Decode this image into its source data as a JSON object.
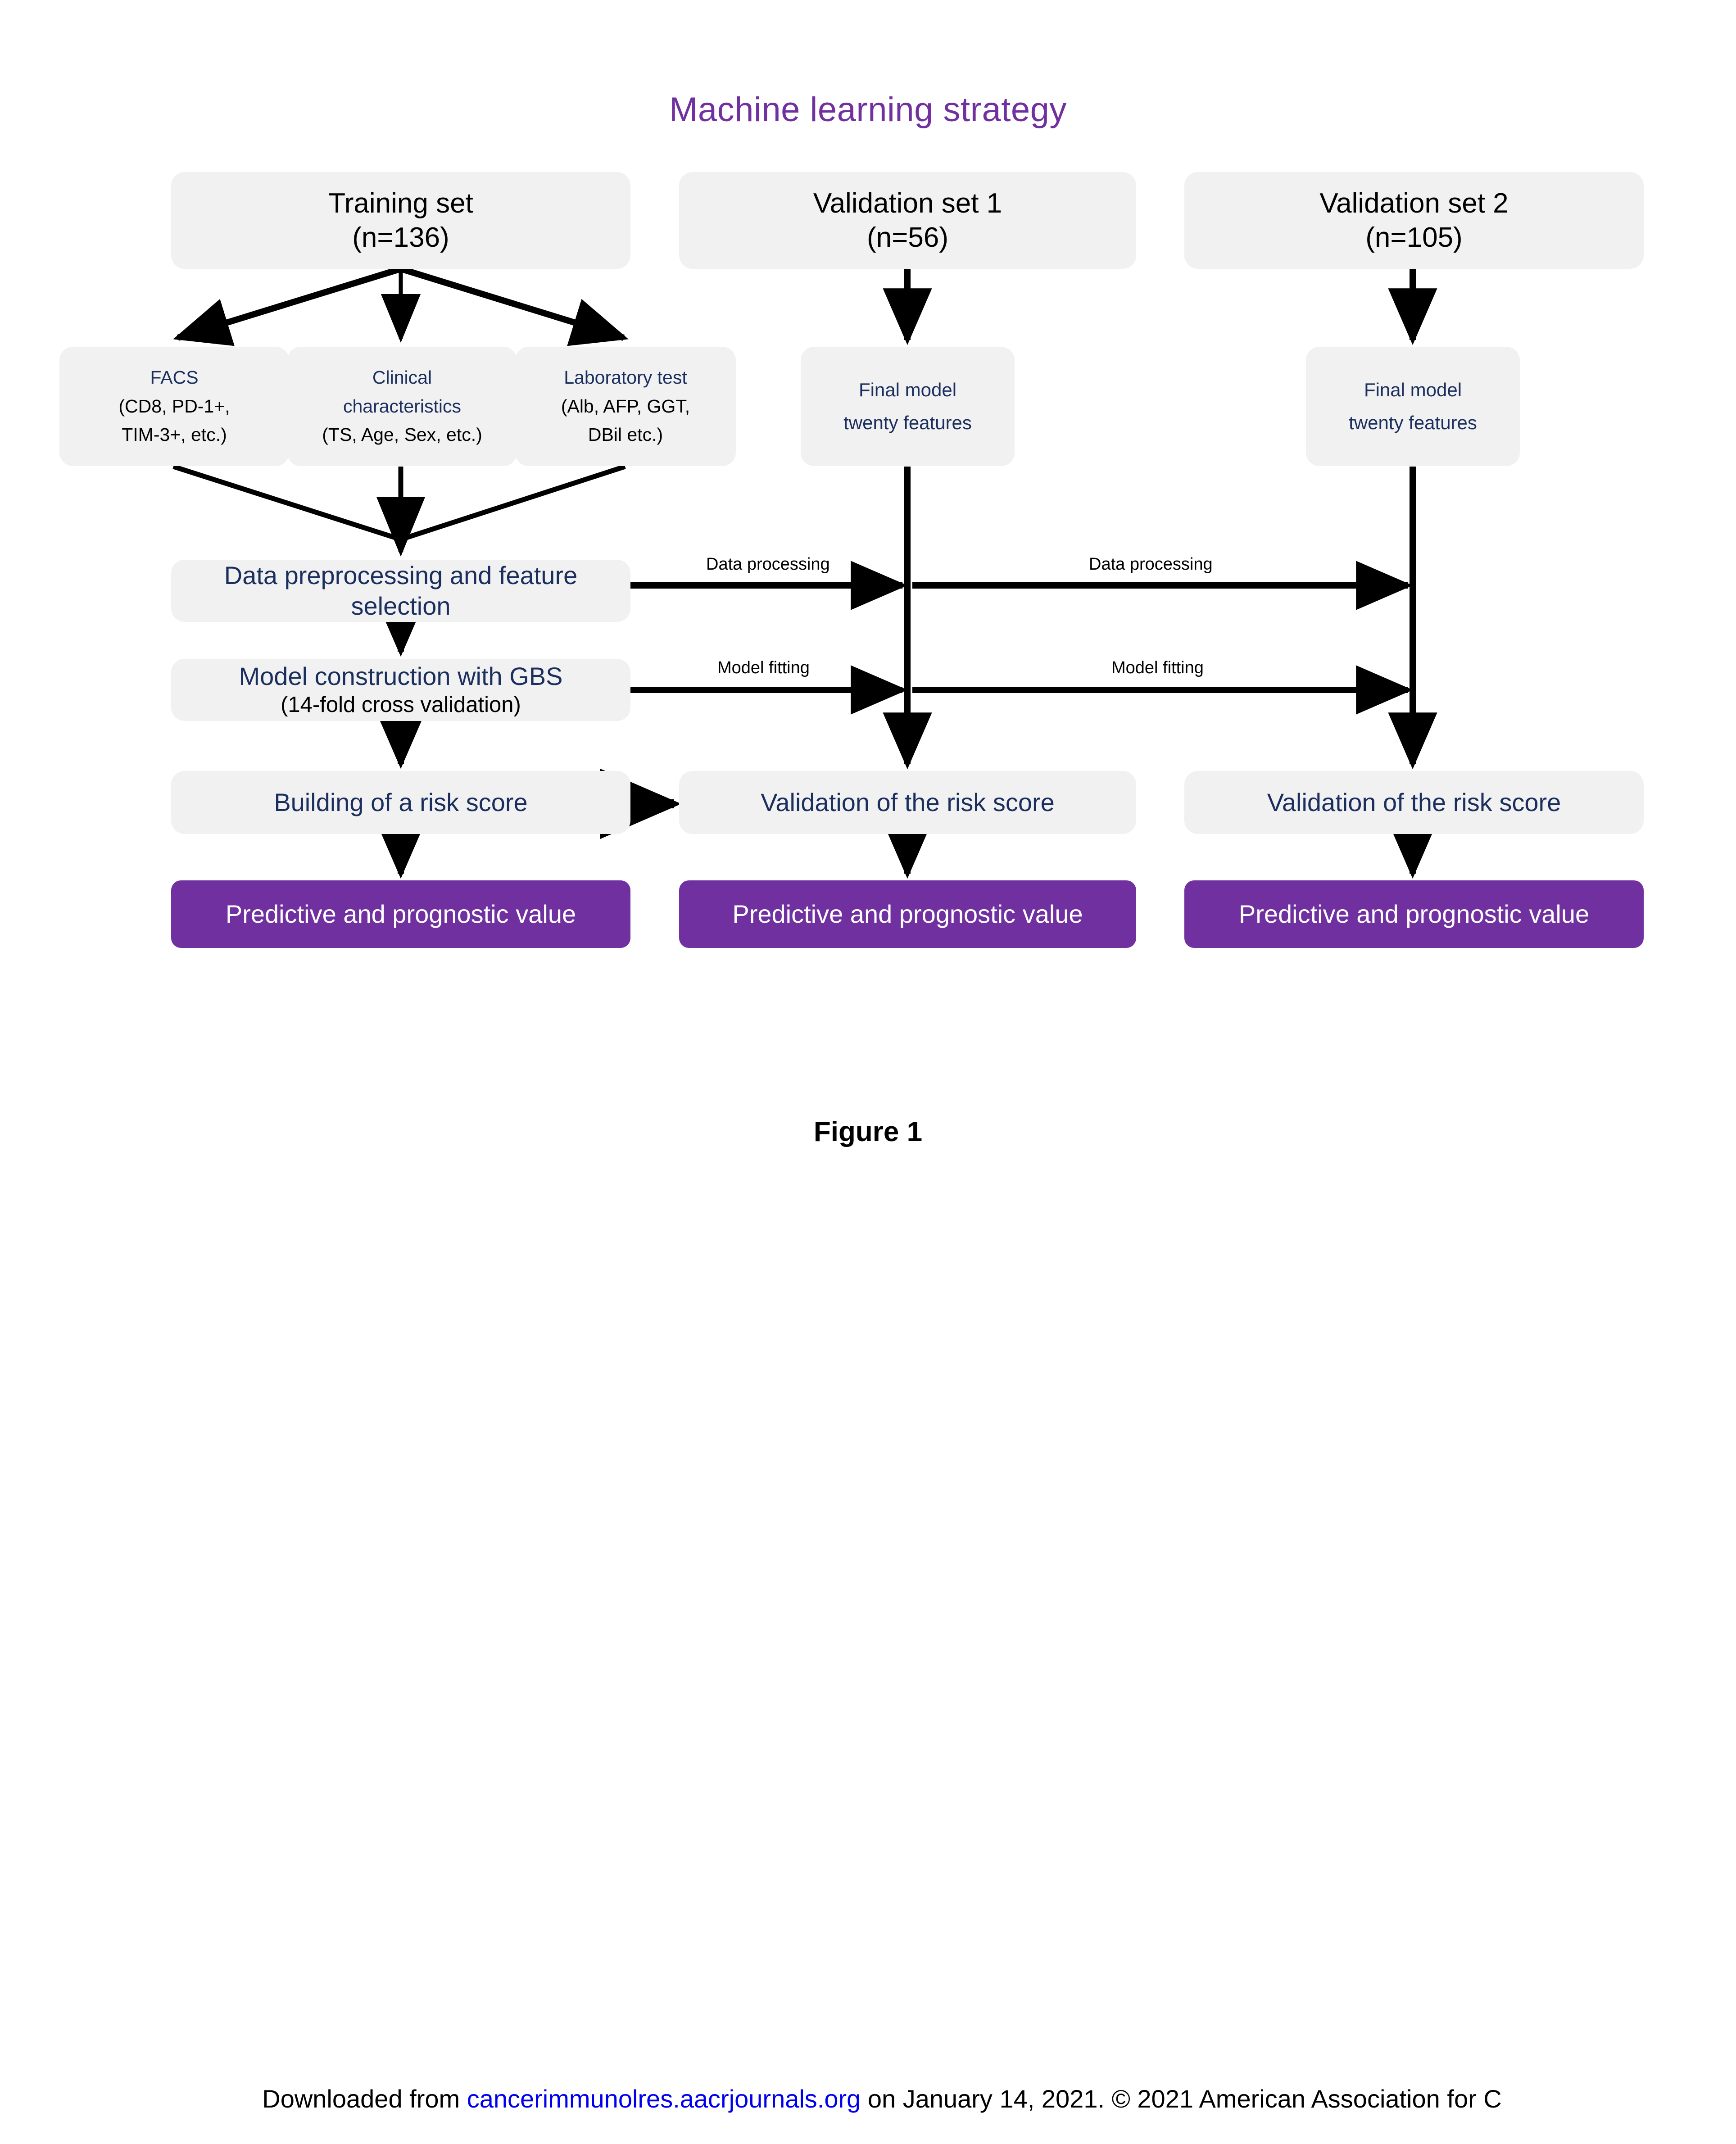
{
  "figure": {
    "title": "Machine  learning strategy",
    "caption": "Figure 1",
    "title_color": "#7030A0",
    "accent_purple": "#7030A0",
    "navy_text": "#1B2F5E",
    "box_grey": "#F1F1F1"
  },
  "cohorts": {
    "training": {
      "name": "Training  set",
      "count": "(n=136)"
    },
    "validation1": {
      "name": "Validation set 1",
      "count": "(n=56)"
    },
    "validation2": {
      "name": "Validation set  2",
      "count": "(n=105)"
    }
  },
  "features": {
    "facs": {
      "title": "FACS",
      "detail_line1": "(CD8, PD-1+,",
      "detail_line2": "TIM-3+, etc.)"
    },
    "clinical": {
      "title": "Clinical",
      "detail_line1": "characteristics",
      "detail_line2": "(TS, Age, Sex, etc.)"
    },
    "laboratory": {
      "title": "Laboratory test",
      "detail_line1": "(Alb, AFP, GGT,",
      "detail_line2": "DBil etc.)"
    }
  },
  "final_model": {
    "line1": "Final model",
    "line2": "twenty features"
  },
  "pipeline": {
    "preprocessing_line1": "Data preprocessing and feature",
    "preprocessing_line2": "selection",
    "model_construction": "Model construction with GBS",
    "model_construction_sub": "(14-fold cross validation)",
    "build_risk_score": "Building of a risk score",
    "validate_risk_score": "Validation of the   risk score"
  },
  "edges": {
    "data_processing_1": "Data processing",
    "data_processing_2": "Data processing",
    "model_fitting_1": "Model fitting",
    "model_fitting_2": "Model fitting"
  },
  "outcome": {
    "label": "Predictive and prognostic value"
  },
  "footer": {
    "prefix": "Downloaded from ",
    "link": "cancerimmunolres.aacrjournals.org",
    "suffix": " on January 14, 2021. © 2021 American Association for C"
  }
}
